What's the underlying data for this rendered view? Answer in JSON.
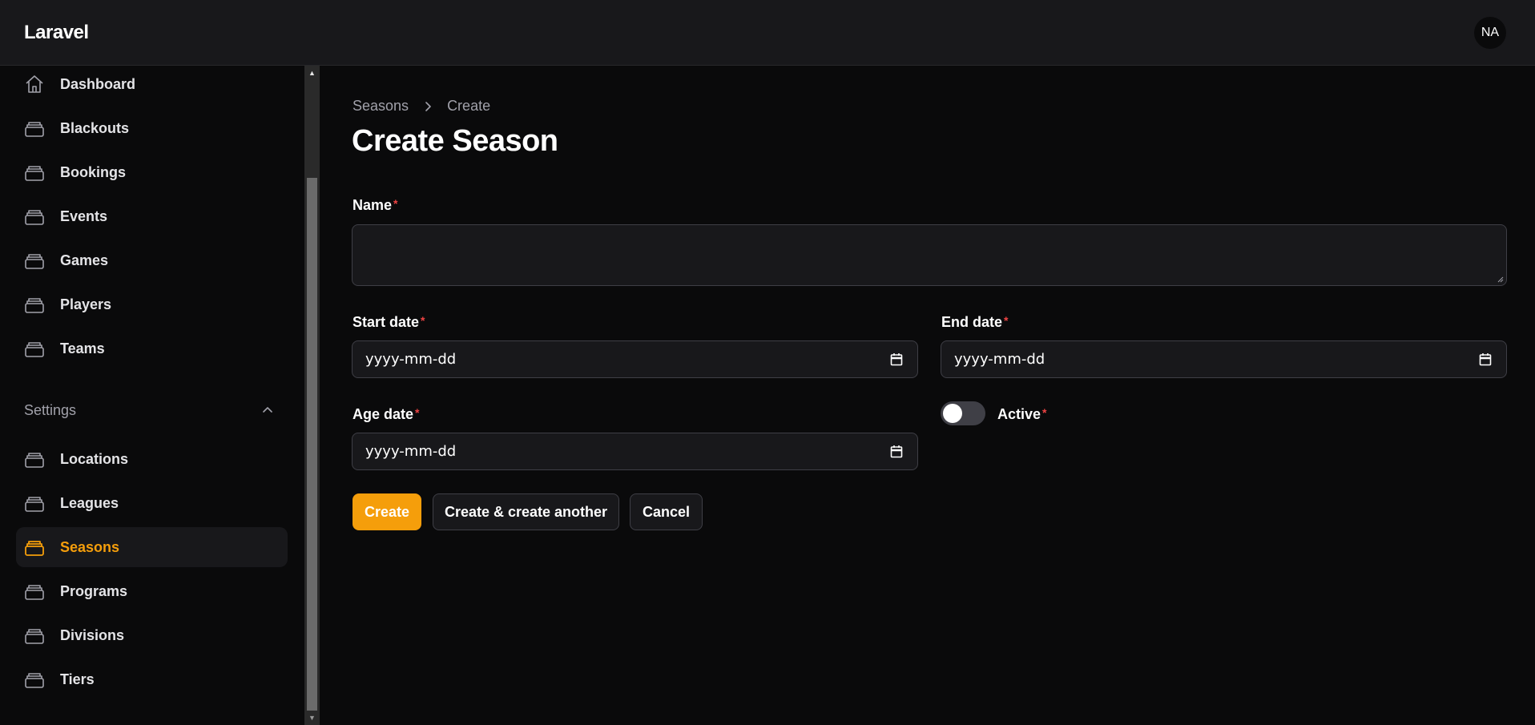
{
  "app": {
    "brand": "Laravel",
    "user_initials": "NA"
  },
  "colors": {
    "accent": "#f59e0b",
    "required": "#ef4444",
    "surface": "#18181b",
    "background": "#0a0a0b"
  },
  "sidebar": {
    "items": [
      {
        "label": "Dashboard",
        "icon": "home-icon"
      },
      {
        "label": "Blackouts",
        "icon": "stack-icon"
      },
      {
        "label": "Bookings",
        "icon": "stack-icon"
      },
      {
        "label": "Events",
        "icon": "stack-icon"
      },
      {
        "label": "Games",
        "icon": "stack-icon"
      },
      {
        "label": "Players",
        "icon": "stack-icon"
      },
      {
        "label": "Teams",
        "icon": "stack-icon"
      }
    ],
    "settings_group": {
      "label": "Settings",
      "items": [
        {
          "label": "Locations",
          "icon": "stack-icon"
        },
        {
          "label": "Leagues",
          "icon": "stack-icon"
        },
        {
          "label": "Seasons",
          "icon": "stack-icon",
          "active": true
        },
        {
          "label": "Programs",
          "icon": "stack-icon"
        },
        {
          "label": "Divisions",
          "icon": "stack-icon"
        },
        {
          "label": "Tiers",
          "icon": "stack-icon"
        }
      ]
    }
  },
  "breadcrumb": {
    "parent": "Seasons",
    "current": "Create"
  },
  "page": {
    "title": "Create Season"
  },
  "form": {
    "name": {
      "label": "Name",
      "required_mark": "*",
      "value": ""
    },
    "start_date": {
      "label": "Start date",
      "required_mark": "*",
      "placeholder": "yyyy-mm-dd"
    },
    "end_date": {
      "label": "End date",
      "required_mark": "*",
      "placeholder": "yyyy-mm-dd"
    },
    "age_date": {
      "label": "Age date",
      "required_mark": "*",
      "placeholder": "yyyy-mm-dd"
    },
    "active": {
      "label": "Active",
      "required_mark": "*",
      "checked": false
    }
  },
  "actions": {
    "create": "Create",
    "create_another": "Create & create another",
    "cancel": "Cancel"
  }
}
